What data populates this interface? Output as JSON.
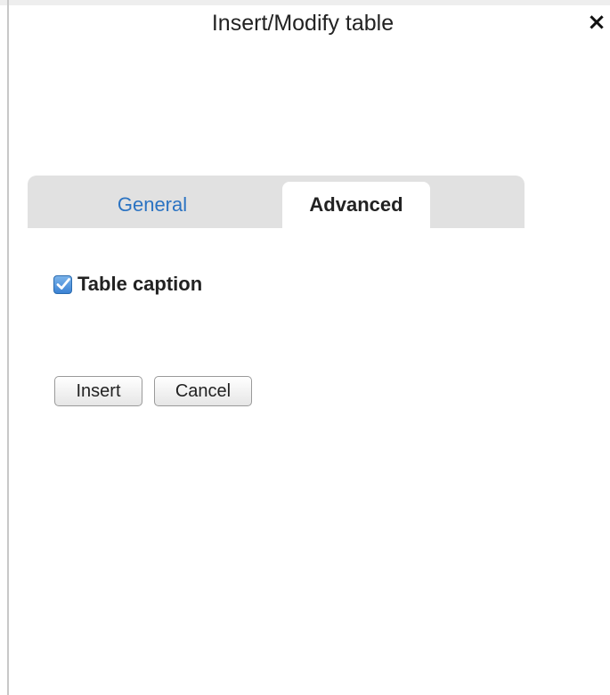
{
  "dialog": {
    "title": "Insert/Modify table",
    "close_symbol": "×"
  },
  "tabs": [
    {
      "label": "General",
      "active": false
    },
    {
      "label": "Advanced",
      "active": true
    }
  ],
  "advanced": {
    "caption_label": "Table caption",
    "caption_checked": true
  },
  "buttons": {
    "insert_label": "Insert",
    "cancel_label": "Cancel"
  },
  "icons": {
    "close": "close-icon",
    "checkbox": "checkmark-icon"
  },
  "colors": {
    "tab_bar": "#e1e1e1",
    "inactive_tab_text": "#2b73c2",
    "checkbox_fill": "#3b82d4"
  }
}
